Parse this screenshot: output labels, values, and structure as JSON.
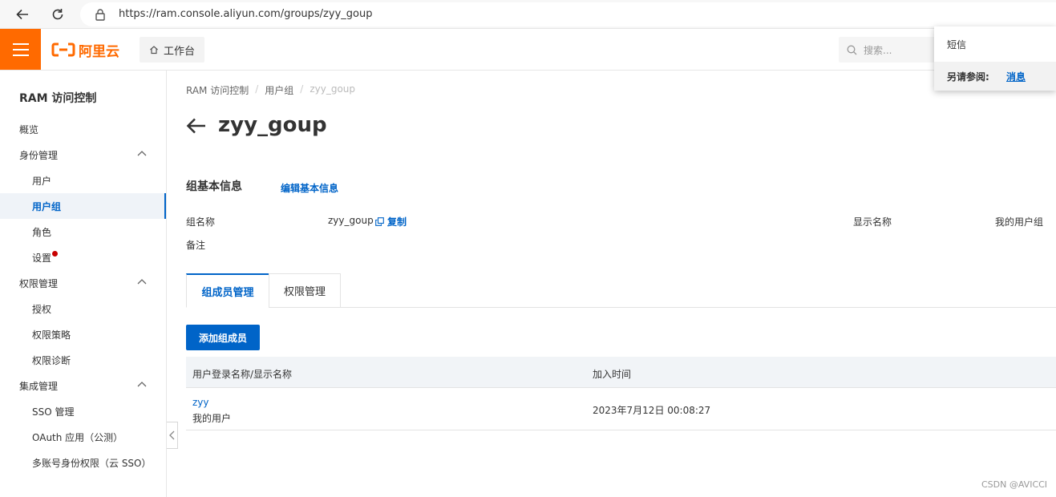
{
  "browser": {
    "url": "https://ram.console.aliyun.com/groups/zyy_goup"
  },
  "topbar": {
    "logo_text": "阿里云",
    "workbench_label": "工作台",
    "search_placeholder": "搜索..."
  },
  "popup": {
    "item": "短信",
    "see_also_label": "另请参阅:",
    "see_also_link": "消息"
  },
  "sidebar": {
    "title": "RAM 访问控制",
    "items": [
      {
        "label": "概览"
      },
      {
        "label": "身份管理"
      },
      {
        "label": "用户"
      },
      {
        "label": "用户组"
      },
      {
        "label": "角色"
      },
      {
        "label": "设置"
      },
      {
        "label": "权限管理"
      },
      {
        "label": "授权"
      },
      {
        "label": "权限策略"
      },
      {
        "label": "权限诊断"
      },
      {
        "label": "集成管理"
      },
      {
        "label": "SSO 管理"
      },
      {
        "label": "OAuth 应用（公测）"
      },
      {
        "label": "多账号身份权限（云 SSO）"
      }
    ],
    "active_item": "用户组"
  },
  "breadcrumb": {
    "items": [
      "RAM 访问控制",
      "用户组",
      "zyy_goup"
    ]
  },
  "page": {
    "title": "zyy_goup"
  },
  "basic_info": {
    "section_title": "组基本信息",
    "edit_link": "编辑基本信息",
    "group_name_label": "组名称",
    "group_name_value": "zyy_goup",
    "copy_label": "复制",
    "display_name_label": "显示名称",
    "display_name_value": "我的用户组",
    "remark_label": "备注"
  },
  "tabs": [
    {
      "label": "组成员管理",
      "active": true
    },
    {
      "label": "权限管理",
      "active": false
    }
  ],
  "add_member_button": "添加组成员",
  "table": {
    "columns": [
      "用户登录名称/显示名称",
      "加入时间"
    ],
    "rows": [
      {
        "login_name": "zyy",
        "display_name": "我的用户",
        "join_time": "2023年7月12日 00:08:27"
      }
    ]
  },
  "watermark": "CSDN @AVICCI",
  "colors": {
    "brand_orange": "#ff6a00",
    "primary_blue": "#0064c8",
    "alert_red": "#c80000"
  }
}
